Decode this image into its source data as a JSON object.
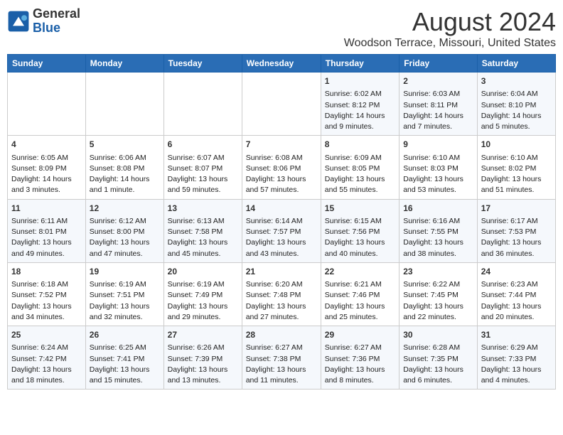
{
  "logo": {
    "text_general": "General",
    "text_blue": "Blue"
  },
  "title": "August 2024",
  "subtitle": "Woodson Terrace, Missouri, United States",
  "weekdays": [
    "Sunday",
    "Monday",
    "Tuesday",
    "Wednesday",
    "Thursday",
    "Friday",
    "Saturday"
  ],
  "weeks": [
    [
      {
        "day": "",
        "info": ""
      },
      {
        "day": "",
        "info": ""
      },
      {
        "day": "",
        "info": ""
      },
      {
        "day": "",
        "info": ""
      },
      {
        "day": "1",
        "info": "Sunrise: 6:02 AM\nSunset: 8:12 PM\nDaylight: 14 hours\nand 9 minutes."
      },
      {
        "day": "2",
        "info": "Sunrise: 6:03 AM\nSunset: 8:11 PM\nDaylight: 14 hours\nand 7 minutes."
      },
      {
        "day": "3",
        "info": "Sunrise: 6:04 AM\nSunset: 8:10 PM\nDaylight: 14 hours\nand 5 minutes."
      }
    ],
    [
      {
        "day": "4",
        "info": "Sunrise: 6:05 AM\nSunset: 8:09 PM\nDaylight: 14 hours\nand 3 minutes."
      },
      {
        "day": "5",
        "info": "Sunrise: 6:06 AM\nSunset: 8:08 PM\nDaylight: 14 hours\nand 1 minute."
      },
      {
        "day": "6",
        "info": "Sunrise: 6:07 AM\nSunset: 8:07 PM\nDaylight: 13 hours\nand 59 minutes."
      },
      {
        "day": "7",
        "info": "Sunrise: 6:08 AM\nSunset: 8:06 PM\nDaylight: 13 hours\nand 57 minutes."
      },
      {
        "day": "8",
        "info": "Sunrise: 6:09 AM\nSunset: 8:05 PM\nDaylight: 13 hours\nand 55 minutes."
      },
      {
        "day": "9",
        "info": "Sunrise: 6:10 AM\nSunset: 8:03 PM\nDaylight: 13 hours\nand 53 minutes."
      },
      {
        "day": "10",
        "info": "Sunrise: 6:10 AM\nSunset: 8:02 PM\nDaylight: 13 hours\nand 51 minutes."
      }
    ],
    [
      {
        "day": "11",
        "info": "Sunrise: 6:11 AM\nSunset: 8:01 PM\nDaylight: 13 hours\nand 49 minutes."
      },
      {
        "day": "12",
        "info": "Sunrise: 6:12 AM\nSunset: 8:00 PM\nDaylight: 13 hours\nand 47 minutes."
      },
      {
        "day": "13",
        "info": "Sunrise: 6:13 AM\nSunset: 7:58 PM\nDaylight: 13 hours\nand 45 minutes."
      },
      {
        "day": "14",
        "info": "Sunrise: 6:14 AM\nSunset: 7:57 PM\nDaylight: 13 hours\nand 43 minutes."
      },
      {
        "day": "15",
        "info": "Sunrise: 6:15 AM\nSunset: 7:56 PM\nDaylight: 13 hours\nand 40 minutes."
      },
      {
        "day": "16",
        "info": "Sunrise: 6:16 AM\nSunset: 7:55 PM\nDaylight: 13 hours\nand 38 minutes."
      },
      {
        "day": "17",
        "info": "Sunrise: 6:17 AM\nSunset: 7:53 PM\nDaylight: 13 hours\nand 36 minutes."
      }
    ],
    [
      {
        "day": "18",
        "info": "Sunrise: 6:18 AM\nSunset: 7:52 PM\nDaylight: 13 hours\nand 34 minutes."
      },
      {
        "day": "19",
        "info": "Sunrise: 6:19 AM\nSunset: 7:51 PM\nDaylight: 13 hours\nand 32 minutes."
      },
      {
        "day": "20",
        "info": "Sunrise: 6:19 AM\nSunset: 7:49 PM\nDaylight: 13 hours\nand 29 minutes."
      },
      {
        "day": "21",
        "info": "Sunrise: 6:20 AM\nSunset: 7:48 PM\nDaylight: 13 hours\nand 27 minutes."
      },
      {
        "day": "22",
        "info": "Sunrise: 6:21 AM\nSunset: 7:46 PM\nDaylight: 13 hours\nand 25 minutes."
      },
      {
        "day": "23",
        "info": "Sunrise: 6:22 AM\nSunset: 7:45 PM\nDaylight: 13 hours\nand 22 minutes."
      },
      {
        "day": "24",
        "info": "Sunrise: 6:23 AM\nSunset: 7:44 PM\nDaylight: 13 hours\nand 20 minutes."
      }
    ],
    [
      {
        "day": "25",
        "info": "Sunrise: 6:24 AM\nSunset: 7:42 PM\nDaylight: 13 hours\nand 18 minutes."
      },
      {
        "day": "26",
        "info": "Sunrise: 6:25 AM\nSunset: 7:41 PM\nDaylight: 13 hours\nand 15 minutes."
      },
      {
        "day": "27",
        "info": "Sunrise: 6:26 AM\nSunset: 7:39 PM\nDaylight: 13 hours\nand 13 minutes."
      },
      {
        "day": "28",
        "info": "Sunrise: 6:27 AM\nSunset: 7:38 PM\nDaylight: 13 hours\nand 11 minutes."
      },
      {
        "day": "29",
        "info": "Sunrise: 6:27 AM\nSunset: 7:36 PM\nDaylight: 13 hours\nand 8 minutes."
      },
      {
        "day": "30",
        "info": "Sunrise: 6:28 AM\nSunset: 7:35 PM\nDaylight: 13 hours\nand 6 minutes."
      },
      {
        "day": "31",
        "info": "Sunrise: 6:29 AM\nSunset: 7:33 PM\nDaylight: 13 hours\nand 4 minutes."
      }
    ]
  ]
}
